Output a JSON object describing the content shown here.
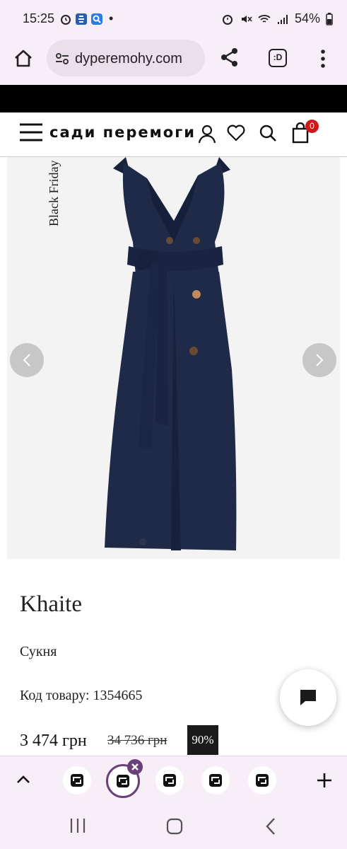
{
  "status_bar": {
    "time": "15:25",
    "dot": "•",
    "battery": "54%",
    "left_icons": [
      "alarm-icon",
      "e-app-icon",
      "search-app-icon"
    ],
    "right_icons": [
      "alarm-icon",
      "mute-icon",
      "wifi-icon",
      "signal-icon",
      "battery-icon"
    ]
  },
  "browser": {
    "url": "dyperemohy.com",
    "tab_count_label": ":D",
    "icons": [
      "home-icon",
      "site-settings-icon",
      "share-icon",
      "tabs-icon",
      "more-icon"
    ]
  },
  "site_header": {
    "logo": "сади перемоги",
    "cart_count": "0",
    "icons": [
      "menu-icon",
      "user-icon",
      "heart-icon",
      "search-icon",
      "cart-icon"
    ]
  },
  "product": {
    "promo_label": "Black Friday",
    "brand": "Khaite",
    "type": "Сукня",
    "code": "Код товару: 1354665",
    "price_current": "3 474 грн",
    "price_old": "34 736 грн",
    "discount": "90%"
  },
  "tab_bar": {
    "icons": [
      "chevron-up-icon",
      "tab-icon",
      "close-icon",
      "plus-icon"
    ],
    "tab_count": 5
  },
  "nav_bar": {
    "icons": [
      "recents-icon",
      "home-icon",
      "back-icon"
    ]
  },
  "colors": {
    "browser_bg": "#f8eef8",
    "url_pill": "#ebdfec",
    "dress": "#1d2845",
    "badge_red": "#cc1a1a",
    "accent_purple": "#6b3f7a"
  }
}
